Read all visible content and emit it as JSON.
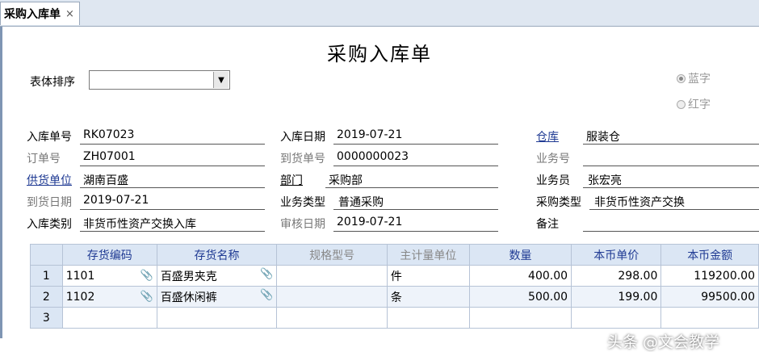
{
  "tab": {
    "title": "采购入库单",
    "close": "×"
  },
  "form": {
    "title": "采购入库单",
    "sort_label": "表体排序",
    "sort_value": "",
    "radio_blue": "蓝字",
    "radio_red": "红字",
    "fields": {
      "receipt_no_label": "入库单号",
      "receipt_no": "RK07023",
      "receipt_date_label": "入库日期",
      "receipt_date": "2019-07-21",
      "warehouse_label": "仓库",
      "warehouse": "服装仓",
      "order_no_label": "订单号",
      "order_no": "ZH07001",
      "arrival_no_label": "到货单号",
      "arrival_no": "0000000023",
      "salesman_no_label": "业务号",
      "salesman_no": "",
      "supplier_label": "供货单位",
      "supplier": "湖南百盛",
      "dept_label": "部门",
      "dept": "采购部",
      "staff_label": "业务员",
      "staff": "张宏亮",
      "arrival_date_label": "到货日期",
      "arrival_date": "2019-07-21",
      "biz_type_label": "业务类型",
      "biz_type": "普通采购",
      "purchase_type_label": "采购类型",
      "purchase_type": "非货币性资产交换",
      "in_type_label": "入库类别",
      "in_type": "非货币性资产交换入库",
      "audit_date_label": "审核日期",
      "audit_date": "2019-07-21",
      "remark_label": "备注",
      "remark": ""
    }
  },
  "table": {
    "headers": [
      "存货编码",
      "存货名称",
      "规格型号",
      "主计量单位",
      "数量",
      "本币单价",
      "本币金额"
    ],
    "rows": [
      {
        "n": "1",
        "code": "1101",
        "name": "百盛男夹克",
        "spec": "",
        "unit": "件",
        "qty": "400.00",
        "price": "298.00",
        "amount": "119200.00"
      },
      {
        "n": "2",
        "code": "1102",
        "name": "百盛休闲裤",
        "spec": "",
        "unit": "条",
        "qty": "500.00",
        "price": "199.00",
        "amount": "99500.00"
      },
      {
        "n": "3",
        "code": "",
        "name": "",
        "spec": "",
        "unit": "",
        "qty": "",
        "price": "",
        "amount": ""
      }
    ]
  },
  "watermark": "头条 @文会教学"
}
